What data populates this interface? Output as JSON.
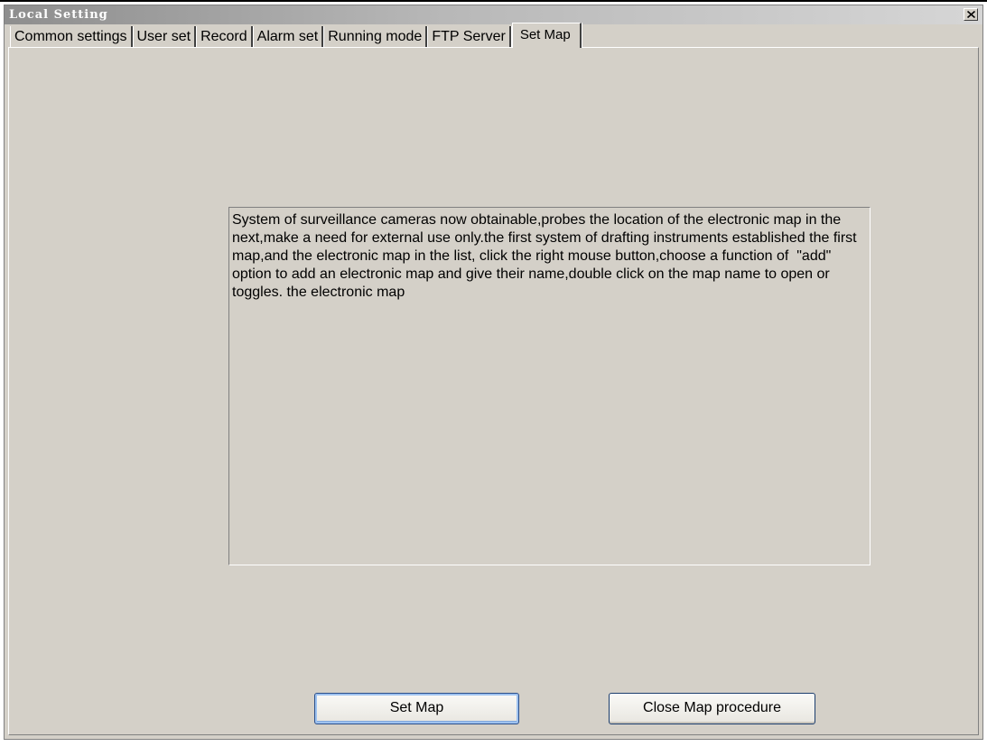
{
  "window": {
    "title": "Local Setting"
  },
  "tabs": [
    {
      "label": "Common settings"
    },
    {
      "label": "User set"
    },
    {
      "label": "Record"
    },
    {
      "label": "Alarm set"
    },
    {
      "label": "Running mode"
    },
    {
      "label": "FTP Server"
    },
    {
      "label": "Set Map",
      "active": true
    }
  ],
  "description": {
    "text": "System of surveillance cameras now obtainable,probes the location of the electronic map in the next,make a need for external use only.the first system of drafting instruments established the first map,and the electronic map in the list, click the right mouse button,choose a function of  \"add\" option to add an electronic map and give their name,double click on the map name to open or toggles. the electronic map"
  },
  "buttons": {
    "set_map": "Set Map",
    "close_map": "Close Map procedure"
  },
  "icons": {
    "close": "close-x-icon"
  },
  "colors": {
    "face": "#d4d0c8",
    "focus_border": "#2b4f8a"
  }
}
